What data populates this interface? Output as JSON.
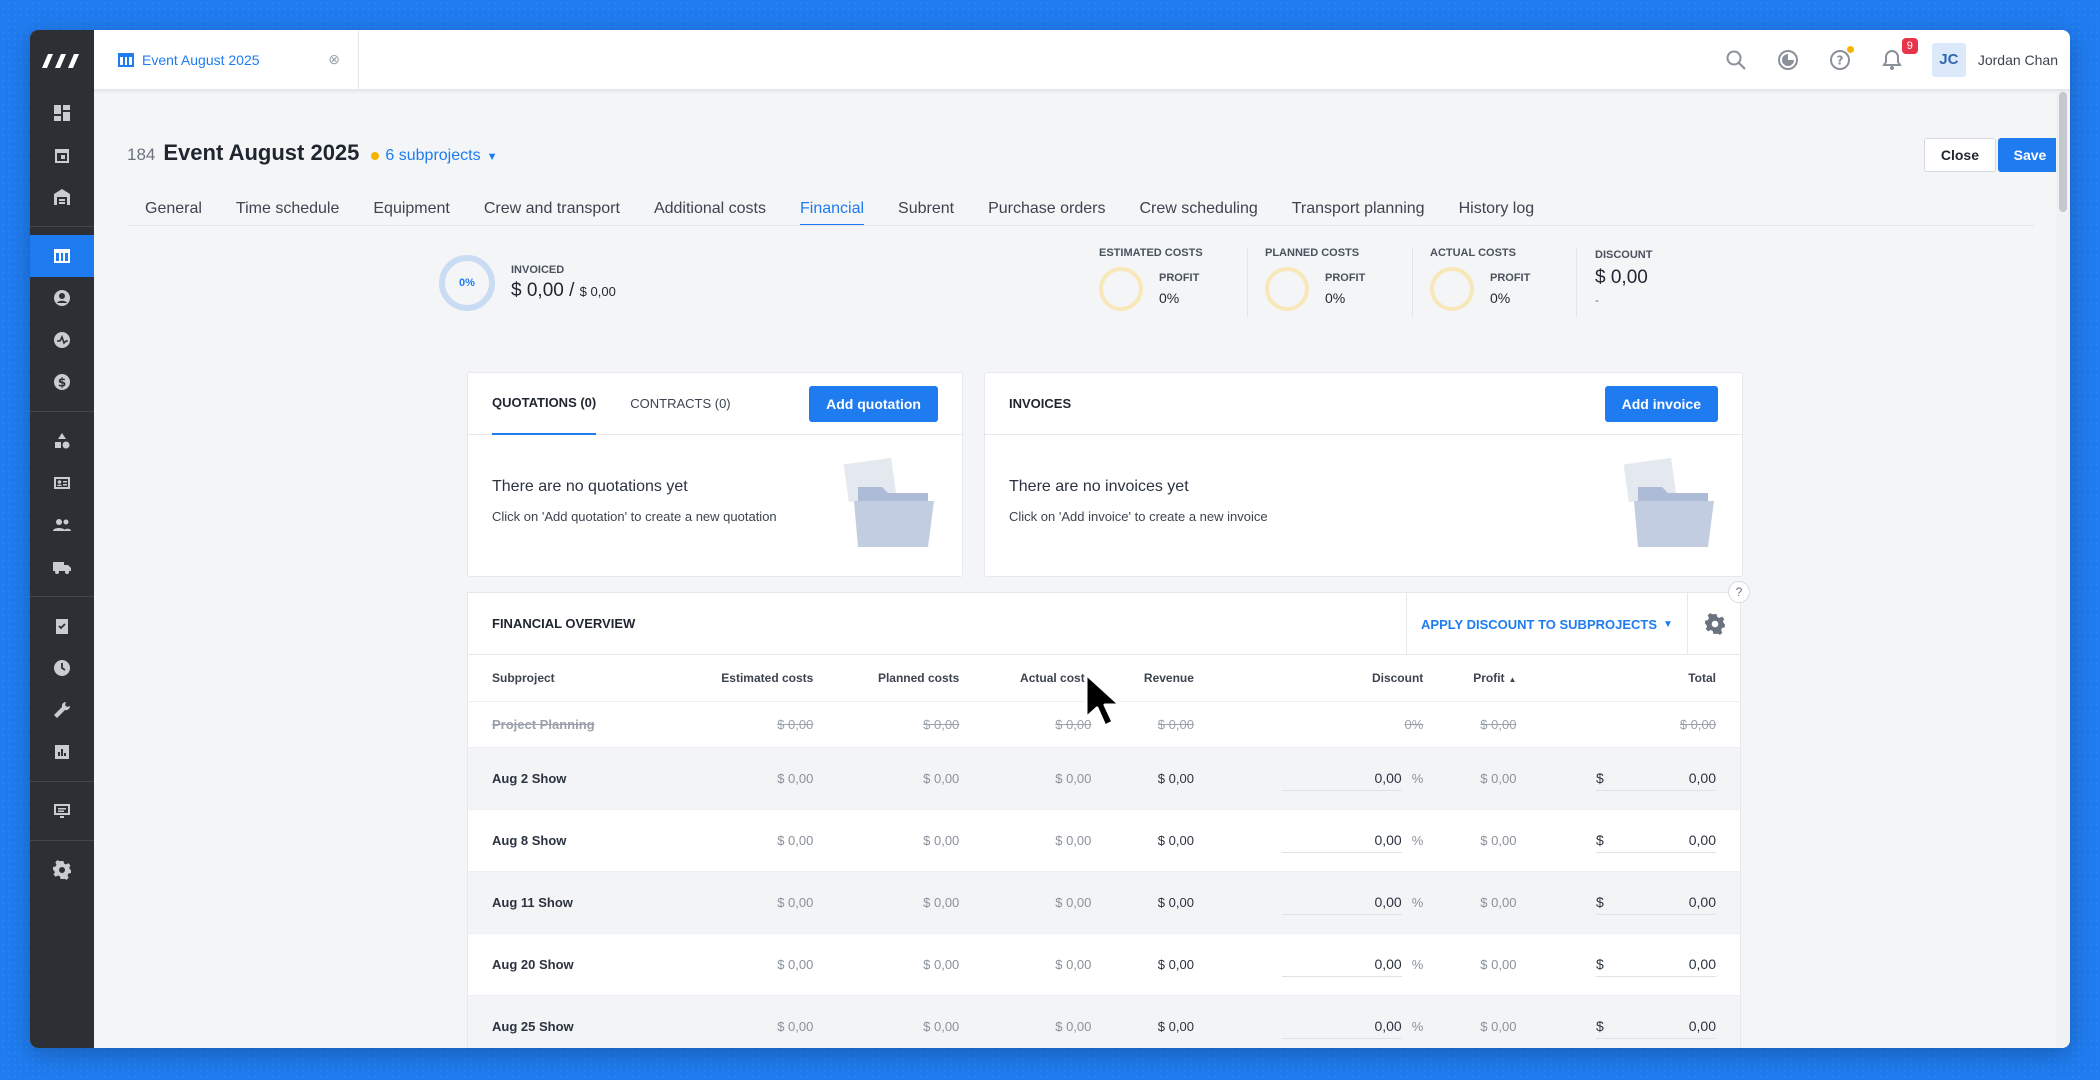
{
  "app": {
    "doc_tab_title": "Event August 2025",
    "user_initials": "JC",
    "user_name": "Jordan Chan",
    "notifications_count": "9"
  },
  "project": {
    "number": "184",
    "title": "Event August 2025",
    "subprojects_label": "6 subprojects"
  },
  "actions": {
    "close": "Close",
    "save": "Save"
  },
  "tabs": [
    {
      "label": "General"
    },
    {
      "label": "Time schedule"
    },
    {
      "label": "Equipment"
    },
    {
      "label": "Crew and transport"
    },
    {
      "label": "Additional costs"
    },
    {
      "label": "Financial"
    },
    {
      "label": "Subrent"
    },
    {
      "label": "Purchase orders"
    },
    {
      "label": "Crew scheduling"
    },
    {
      "label": "Transport planning"
    },
    {
      "label": "History log"
    }
  ],
  "active_tab": "Financial",
  "summary": {
    "invoiced_pct": "0%",
    "invoiced_label": "INVOICED",
    "invoiced_value": "$ 0,00",
    "invoiced_sep": " / ",
    "invoiced_total": "$ 0,00",
    "estimated": {
      "label": "ESTIMATED COSTS",
      "profit_label": "PROFIT",
      "profit": "0%"
    },
    "planned": {
      "label": "PLANNED COSTS",
      "profit_label": "PROFIT",
      "profit": "0%"
    },
    "actual": {
      "label": "ACTUAL COSTS",
      "profit_label": "PROFIT",
      "profit": "0%"
    },
    "discount": {
      "label": "DISCOUNT",
      "value": "$ 0,00",
      "sub": "-"
    }
  },
  "quotations": {
    "tab_quotations": "QUOTATIONS (0)",
    "tab_contracts": "CONTRACTS (0)",
    "add_button": "Add quotation",
    "empty_title": "There are no quotations yet",
    "empty_sub": "Click on 'Add quotation' to create a new quotation"
  },
  "invoices": {
    "title": "INVOICES",
    "add_button": "Add invoice",
    "empty_title": "There are no invoices yet",
    "empty_sub": "Click on 'Add invoice' to create a new invoice"
  },
  "financial_overview": {
    "title": "FINANCIAL OVERVIEW",
    "apply_discount": "APPLY DISCOUNT TO SUBPROJECTS",
    "columns": [
      "Subproject",
      "Estimated costs",
      "Planned costs",
      "Actual costs",
      "Revenue",
      "Discount",
      "Profit",
      "Total"
    ],
    "planning_row": {
      "name": "Project Planning",
      "estimated": "$ 0,00",
      "planned": "$ 0,00",
      "actual": "$ 0,00",
      "revenue": "$ 0,00",
      "discount": "0%",
      "profit": "$ 0,00",
      "total": "$ 0,00"
    },
    "rows": [
      {
        "name": "Aug 2 Show",
        "estimated": "$ 0,00",
        "planned": "$ 0,00",
        "actual": "$ 0,00",
        "revenue": "$ 0,00",
        "discount": "0,00",
        "pct": "%",
        "profit": "$ 0,00",
        "currency": "$",
        "total": "0,00"
      },
      {
        "name": "Aug 8 Show",
        "estimated": "$ 0,00",
        "planned": "$ 0,00",
        "actual": "$ 0,00",
        "revenue": "$ 0,00",
        "discount": "0,00",
        "pct": "%",
        "profit": "$ 0,00",
        "currency": "$",
        "total": "0,00"
      },
      {
        "name": "Aug 11 Show",
        "estimated": "$ 0,00",
        "planned": "$ 0,00",
        "actual": "$ 0,00",
        "revenue": "$ 0,00",
        "discount": "0,00",
        "pct": "%",
        "profit": "$ 0,00",
        "currency": "$",
        "total": "0,00"
      },
      {
        "name": "Aug 20 Show",
        "estimated": "$ 0,00",
        "planned": "$ 0,00",
        "actual": "$ 0,00",
        "revenue": "$ 0,00",
        "discount": "0,00",
        "pct": "%",
        "profit": "$ 0,00",
        "currency": "$",
        "total": "0,00"
      },
      {
        "name": "Aug 25 Show",
        "estimated": "$ 0,00",
        "planned": "$ 0,00",
        "actual": "$ 0,00",
        "revenue": "$ 0,00",
        "discount": "0,00",
        "pct": "%",
        "profit": "$ 0,00",
        "currency": "$",
        "total": "0,00"
      }
    ]
  },
  "colors": {
    "accent": "#1f7cf0",
    "sidebar": "#2c2f34",
    "warning_dot": "#f5b400",
    "badge": "#e8344a"
  }
}
